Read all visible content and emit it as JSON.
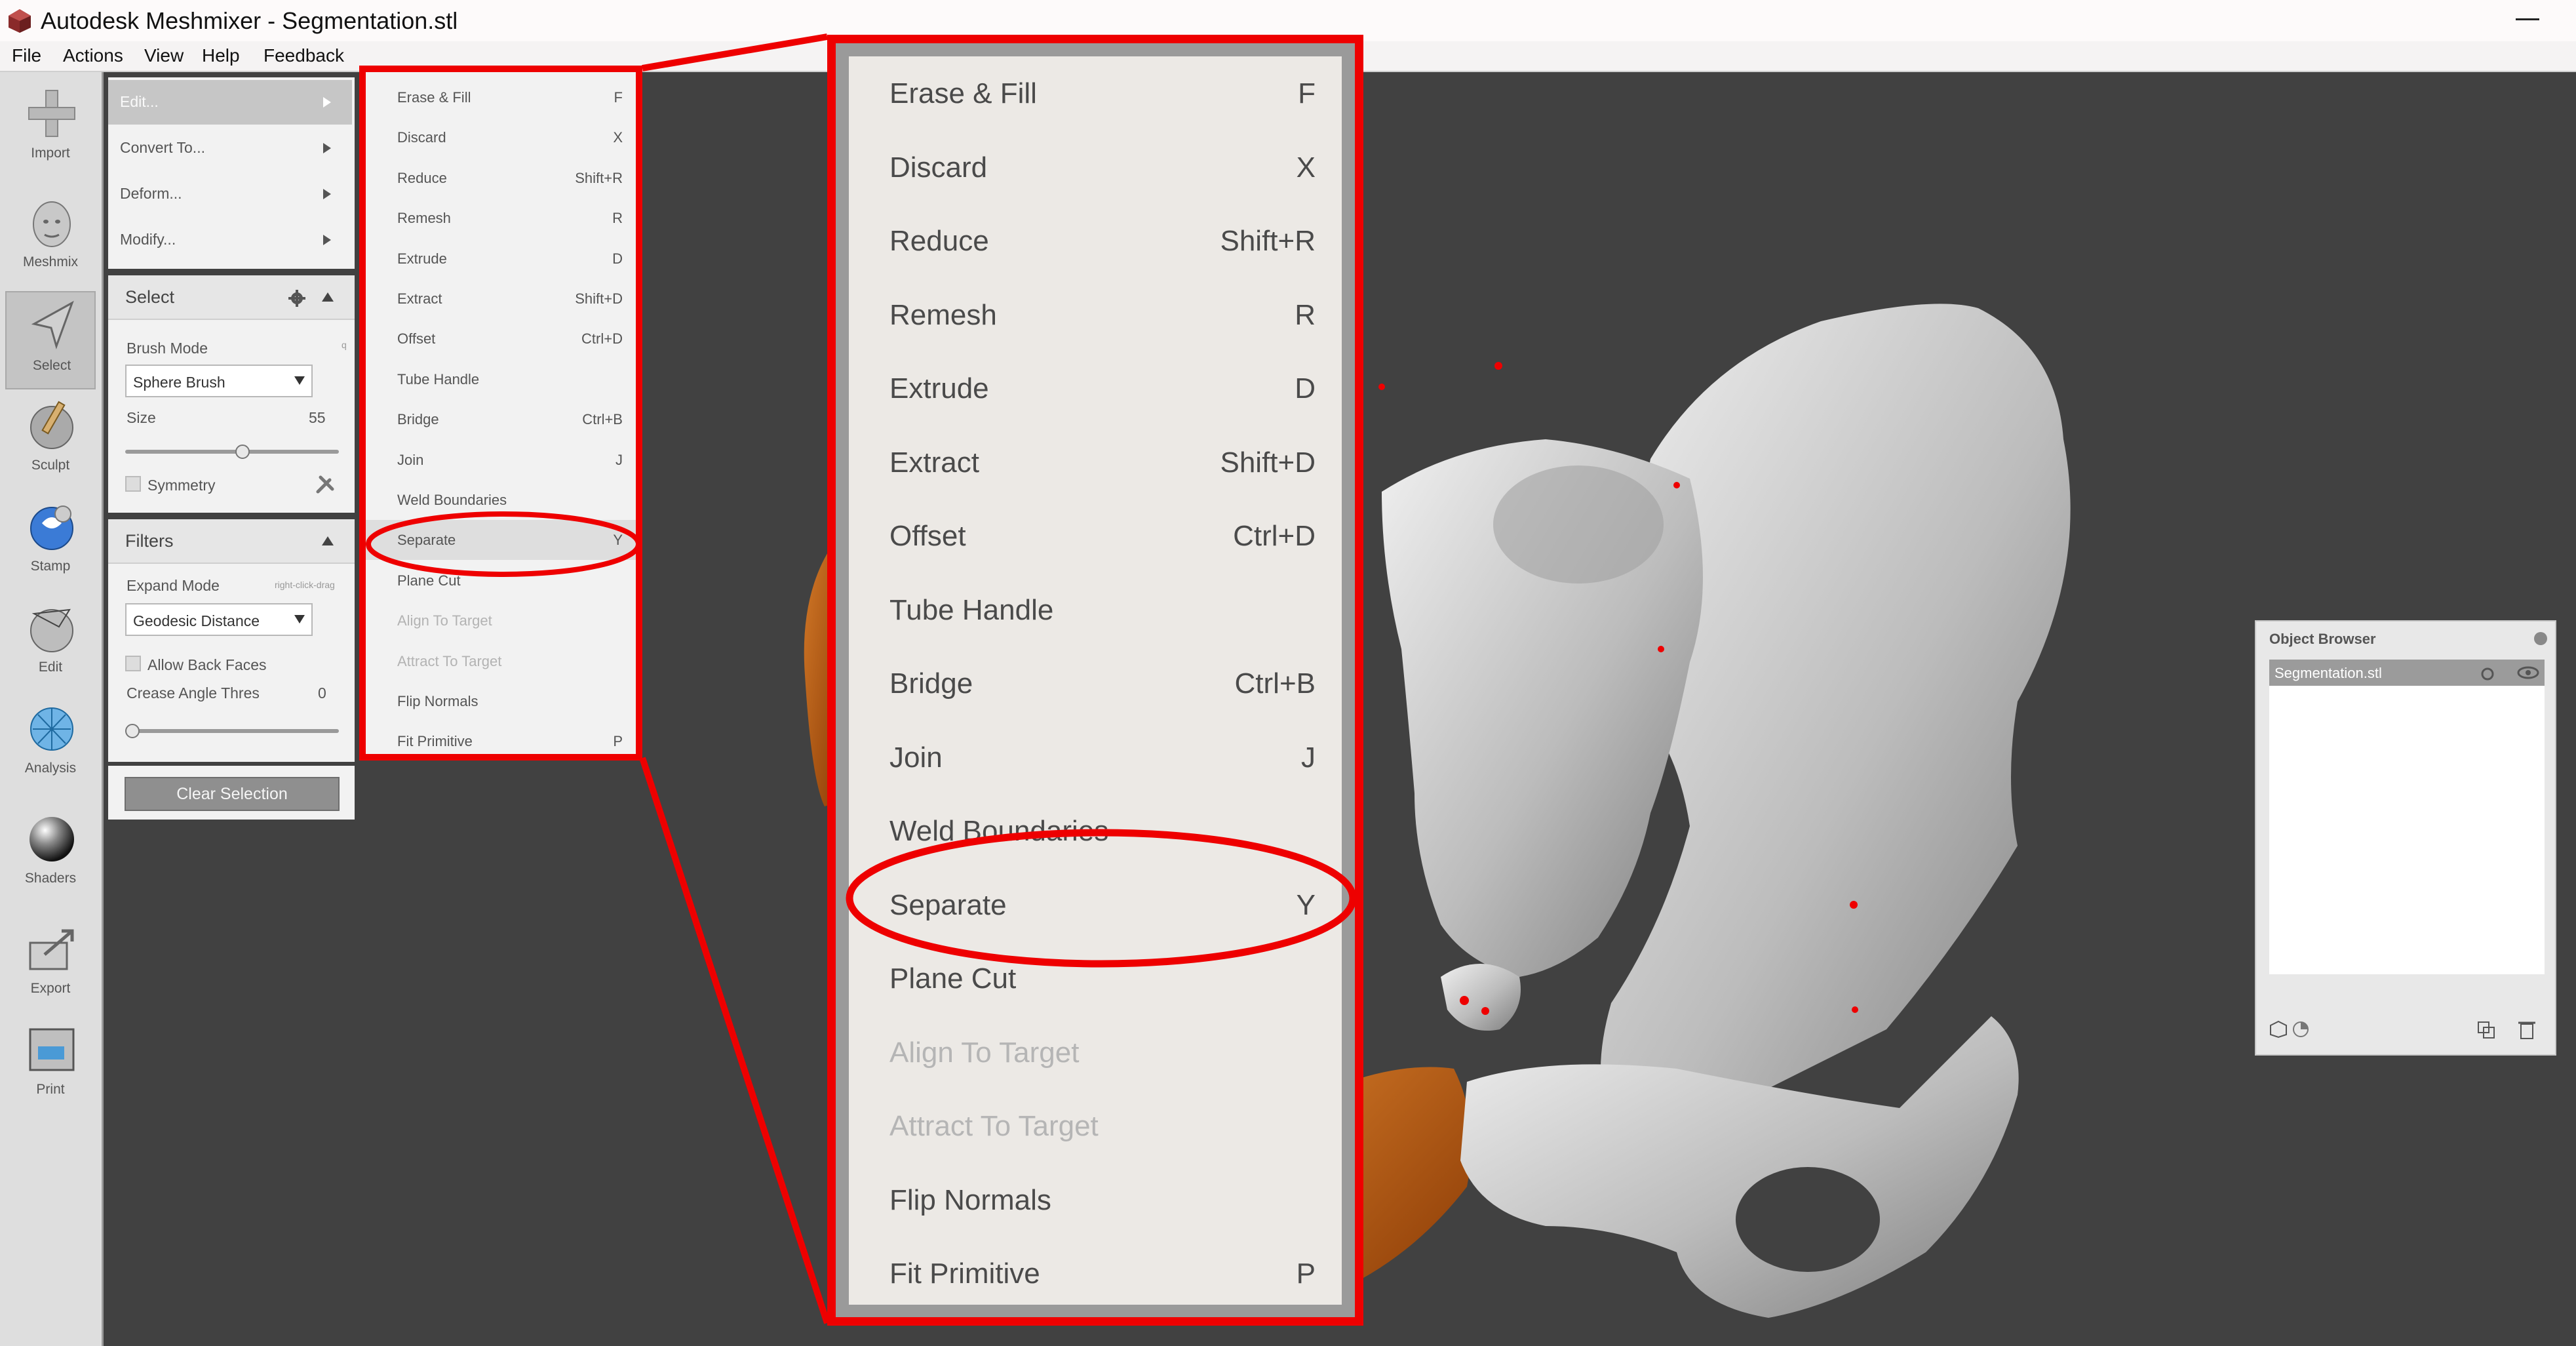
{
  "window": {
    "title": "Autodesk Meshmixer - Segmentation.stl"
  },
  "menubar": [
    "File",
    "Actions",
    "View",
    "Help",
    "Feedback"
  ],
  "toolbar": [
    {
      "label": "Import",
      "icon": "plus-icon"
    },
    {
      "label": "Meshmix",
      "icon": "head-icon"
    },
    {
      "label": "Select",
      "icon": "cursor-arrow-icon",
      "active": true
    },
    {
      "label": "Sculpt",
      "icon": "brush-icon"
    },
    {
      "label": "Stamp",
      "icon": "stamp-icon"
    },
    {
      "label": "Edit",
      "icon": "edit-sphere-icon"
    },
    {
      "label": "Analysis",
      "icon": "analysis-sphere-icon"
    },
    {
      "label": "Shaders",
      "icon": "shader-sphere-icon"
    },
    {
      "label": "Export",
      "icon": "export-icon"
    },
    {
      "label": "Print",
      "icon": "printer-icon"
    }
  ],
  "submenu_list": [
    "Edit...",
    "Convert To...",
    "Deform...",
    "Modify..."
  ],
  "select_panel": {
    "title": "Select",
    "brush_mode_label": "Brush Mode",
    "brush_mode_hint": "q",
    "brush_mode_value": "Sphere Brush",
    "size_label": "Size",
    "size_value": "55",
    "size_fraction": 0.55,
    "symmetry_label": "Symmetry"
  },
  "filters_panel": {
    "title": "Filters",
    "expand_mode_label": "Expand Mode",
    "expand_mode_hint": "right-click-drag",
    "expand_mode_value": "Geodesic Distance",
    "allow_back_faces_label": "Allow Back Faces",
    "crease_label": "Crease Angle Thres",
    "crease_value": "0"
  },
  "clear_selection_label": "Clear Selection",
  "edit_menu": [
    {
      "label": "Erase & Fill",
      "shortcut": "F",
      "enabled": true
    },
    {
      "label": "Discard",
      "shortcut": "X",
      "enabled": true
    },
    {
      "label": "Reduce",
      "shortcut": "Shift+R",
      "enabled": true
    },
    {
      "label": "Remesh",
      "shortcut": "R",
      "enabled": true
    },
    {
      "label": "Extrude",
      "shortcut": "D",
      "enabled": true
    },
    {
      "label": "Extract",
      "shortcut": "Shift+D",
      "enabled": true
    },
    {
      "label": "Offset",
      "shortcut": "Ctrl+D",
      "enabled": true
    },
    {
      "label": "Tube Handle",
      "shortcut": "",
      "enabled": true
    },
    {
      "label": "Bridge",
      "shortcut": "Ctrl+B",
      "enabled": true
    },
    {
      "label": "Join",
      "shortcut": "J",
      "enabled": true
    },
    {
      "label": "Weld Boundaries",
      "shortcut": "",
      "enabled": true
    },
    {
      "label": "Separate",
      "shortcut": "Y",
      "enabled": true,
      "highlighted": true
    },
    {
      "label": "Plane Cut",
      "shortcut": "",
      "enabled": true
    },
    {
      "label": "Align To Target",
      "shortcut": "",
      "enabled": false
    },
    {
      "label": "Attract To Target",
      "shortcut": "",
      "enabled": false
    },
    {
      "label": "Flip Normals",
      "shortcut": "",
      "enabled": true
    },
    {
      "label": "Fit Primitive",
      "shortcut": "P",
      "enabled": true
    }
  ],
  "object_browser": {
    "title": "Object Browser",
    "items": [
      "Segmentation.stl"
    ]
  },
  "colors": {
    "annotation_red": "#ee0000",
    "viewport_bg": "#414141",
    "bone_mesh": "#cfcfcf",
    "selected_mesh": "#b85a12"
  }
}
